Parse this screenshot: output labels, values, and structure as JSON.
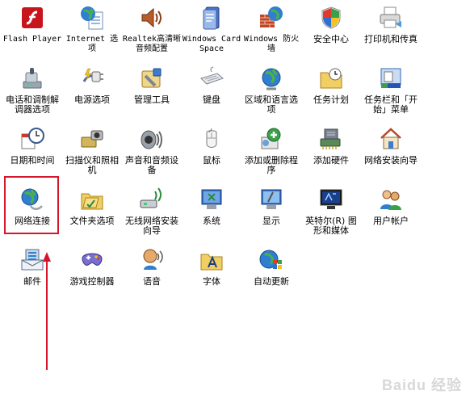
{
  "control_panel": {
    "items": [
      {
        "id": "flash-player",
        "label": "Flash Player",
        "icon": "flash-icon",
        "mono": true
      },
      {
        "id": "internet-options",
        "label": "Internet 选项",
        "icon": "globe-doc-icon",
        "mono": true
      },
      {
        "id": "realtek-audio",
        "label": "Realtek高清晰音频配置",
        "icon": "speaker-icon",
        "mono": true
      },
      {
        "id": "windows-cardspace",
        "label": "Windows CardSpace",
        "icon": "card-icon",
        "mono": true
      },
      {
        "id": "windows-firewall",
        "label": "Windows 防火墙",
        "icon": "firewall-icon",
        "mono": true
      },
      {
        "id": "security-center",
        "label": "安全中心",
        "icon": "shield-icon"
      },
      {
        "id": "printers-faxes",
        "label": "打印机和传真",
        "icon": "printer-icon"
      },
      {
        "id": "phone-modem",
        "label": "电话和调制解调器选项",
        "icon": "phone-icon"
      },
      {
        "id": "power-options",
        "label": "电源选项",
        "icon": "power-plug-icon"
      },
      {
        "id": "admin-tools",
        "label": "管理工具",
        "icon": "admin-tools-icon"
      },
      {
        "id": "keyboard",
        "label": "键盘",
        "icon": "keyboard-icon"
      },
      {
        "id": "regional-language",
        "label": "区域和语言选项",
        "icon": "globe-icon"
      },
      {
        "id": "scheduled-tasks",
        "label": "任务计划",
        "icon": "folder-clock-icon"
      },
      {
        "id": "taskbar-start",
        "label": "任务栏和「开始」菜单",
        "icon": "taskbar-icon"
      },
      {
        "id": "date-time",
        "label": "日期和时间",
        "icon": "calendar-clock-icon"
      },
      {
        "id": "scanners-cameras",
        "label": "扫描仪和照相机",
        "icon": "scanner-camera-icon"
      },
      {
        "id": "sounds-audio",
        "label": "声音和音频设备",
        "icon": "sound-device-icon"
      },
      {
        "id": "mouse",
        "label": "鼠标",
        "icon": "mouse-icon"
      },
      {
        "id": "add-remove-programs",
        "label": "添加或删除程序",
        "icon": "add-remove-icon"
      },
      {
        "id": "add-hardware",
        "label": "添加硬件",
        "icon": "hardware-icon"
      },
      {
        "id": "network-setup-wizard",
        "label": "网络安装向导",
        "icon": "home-network-icon"
      },
      {
        "id": "network-connections",
        "label": "网络连接",
        "icon": "network-globe-icon"
      },
      {
        "id": "folder-options",
        "label": "文件夹选项",
        "icon": "folder-options-icon"
      },
      {
        "id": "wireless-wizard",
        "label": "无线网络安装向导",
        "icon": "wireless-icon"
      },
      {
        "id": "system",
        "label": "系统",
        "icon": "system-icon"
      },
      {
        "id": "display",
        "label": "显示",
        "icon": "display-icon"
      },
      {
        "id": "intel-graphics",
        "label": "英特尔(R) 图形和媒体",
        "icon": "intel-monitor-icon"
      },
      {
        "id": "user-accounts",
        "label": "用户帐户",
        "icon": "users-icon"
      },
      {
        "id": "mail",
        "label": "邮件",
        "icon": "mail-icon"
      },
      {
        "id": "game-controllers",
        "label": "游戏控制器",
        "icon": "gamepad-icon"
      },
      {
        "id": "speech",
        "label": "语音",
        "icon": "speech-icon"
      },
      {
        "id": "fonts",
        "label": "字体",
        "icon": "fonts-folder-icon"
      },
      {
        "id": "automatic-updates",
        "label": "自动更新",
        "icon": "windows-update-icon"
      }
    ]
  },
  "annotation": {
    "highlight_target": "network-connections",
    "highlight_color": "#d6162a",
    "arrow_color": "#d6162a"
  },
  "watermark": "Baidu 经验"
}
